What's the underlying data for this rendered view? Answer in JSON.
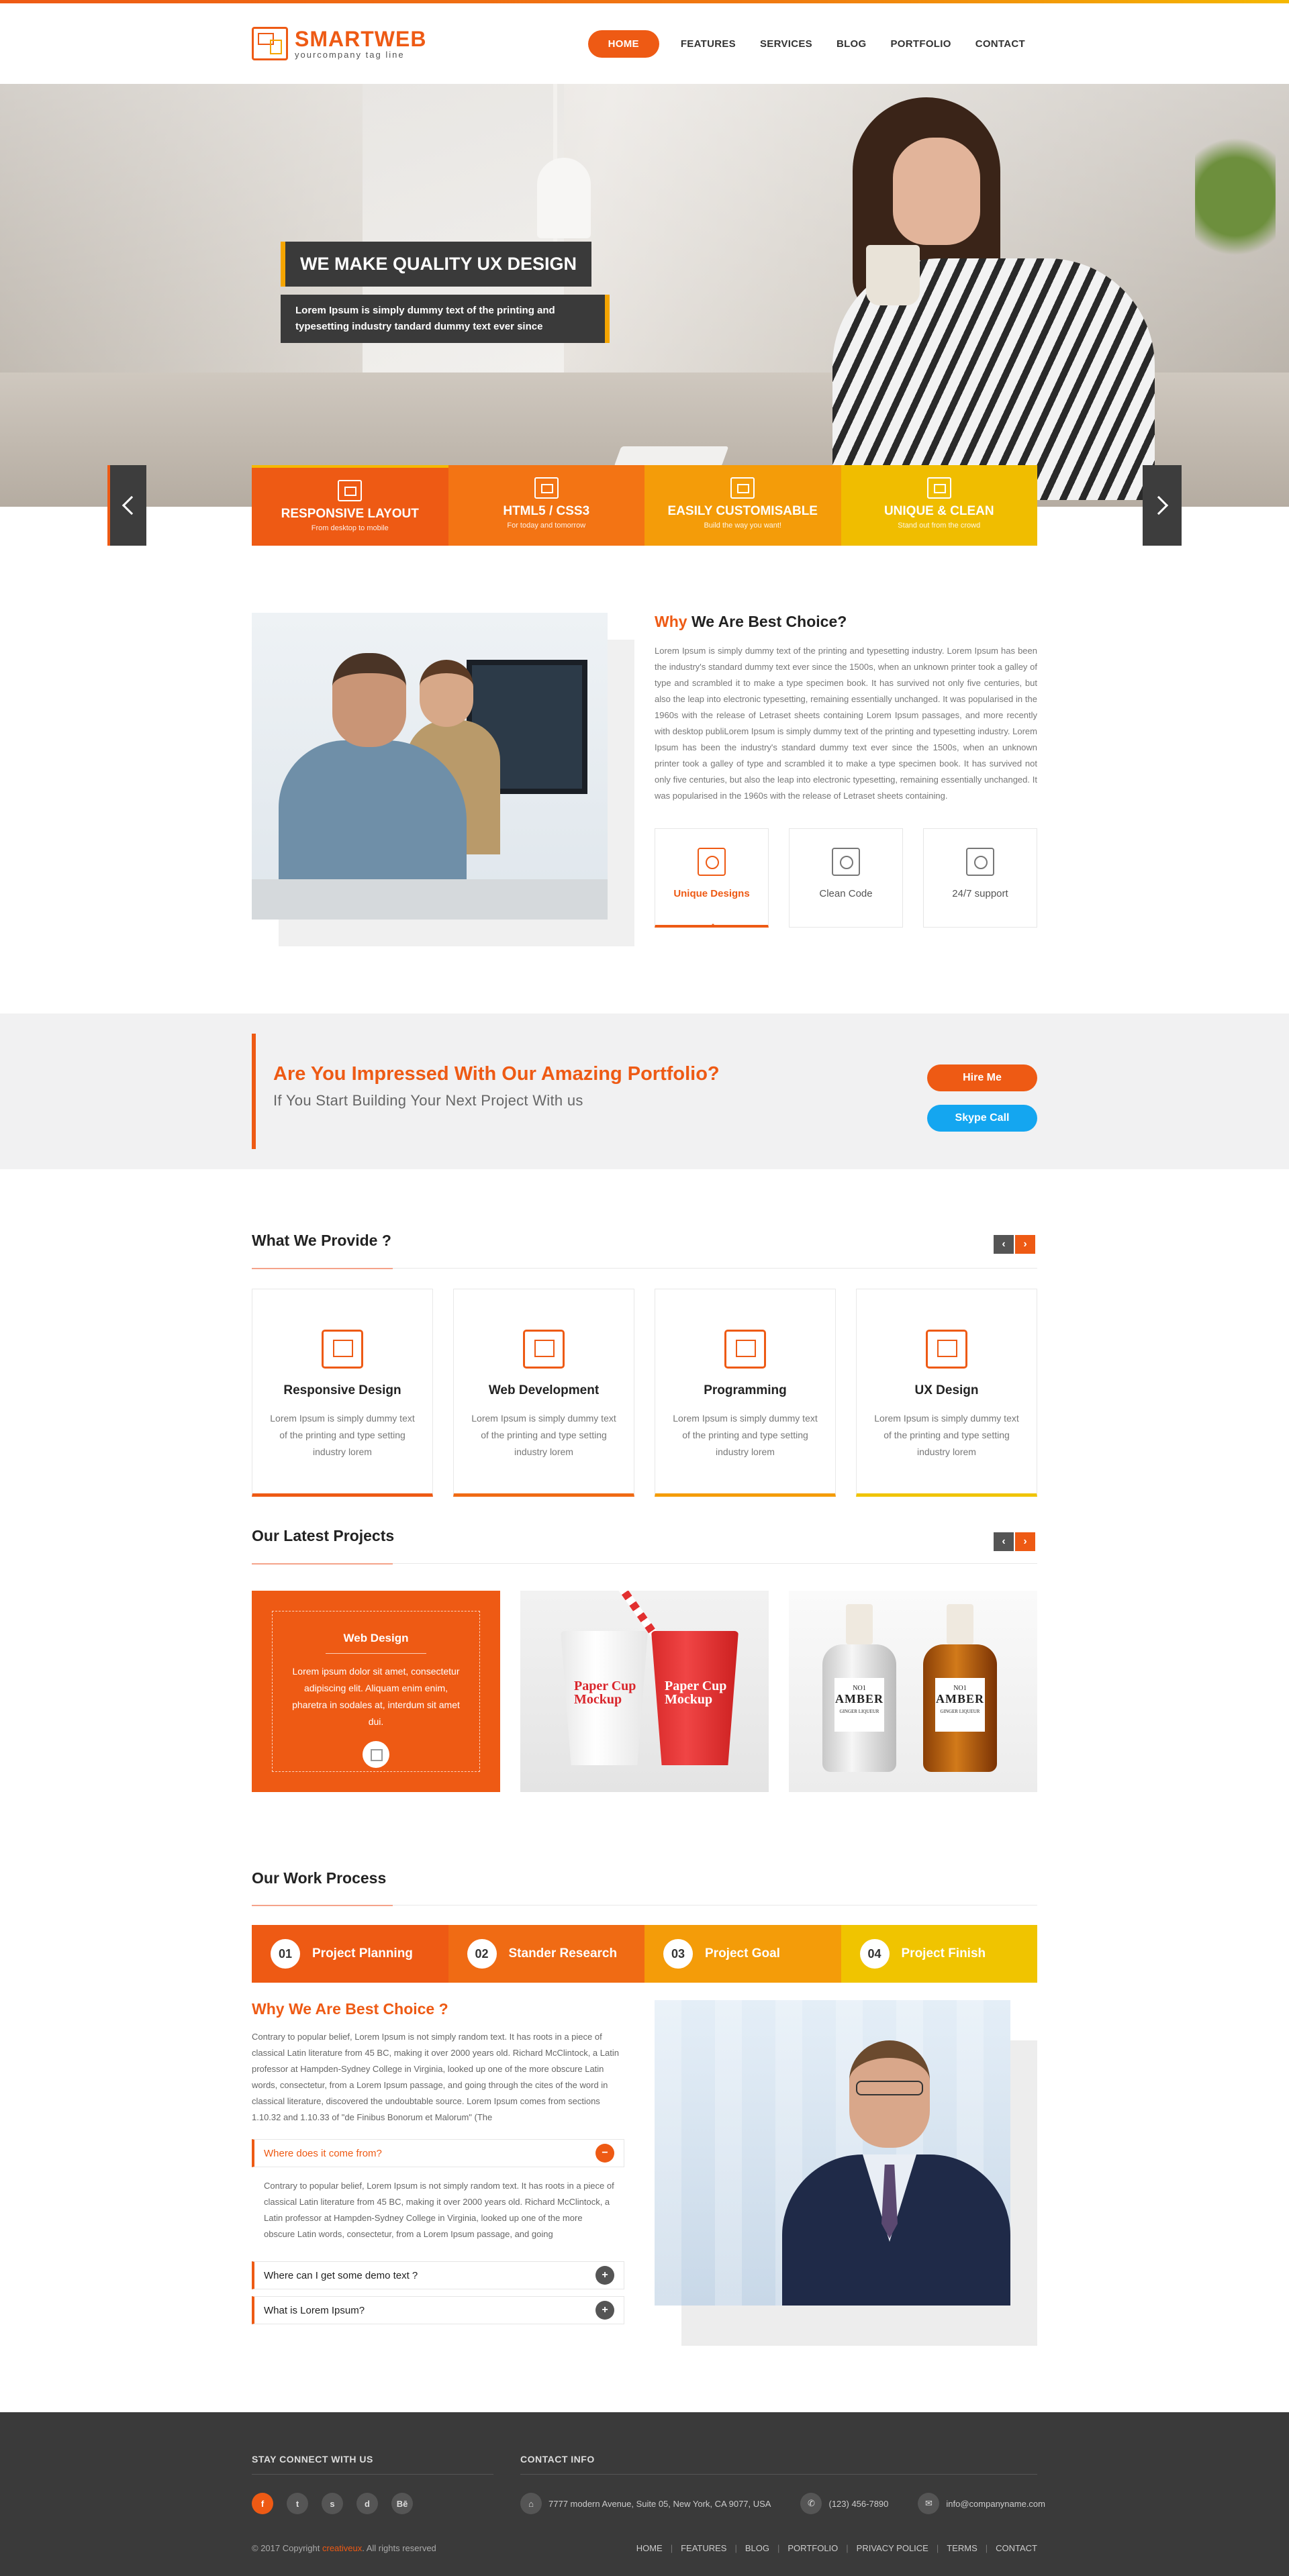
{
  "brand": {
    "name": "SMARTWEB",
    "tagline": "yourcompany tag line",
    "accent": "#ee5a14",
    "accent2": "#f5a500"
  },
  "nav": {
    "items": [
      "HOME",
      "FEATURES",
      "SERVICES",
      "BLOG",
      "PORTFOLIO",
      "CONTACT"
    ],
    "active": "HOME"
  },
  "hero": {
    "title": "WE MAKE QUALITY UX DESIGN",
    "subtitle": "Lorem Ipsum is simply dummy text of the printing and typesetting industry tandard dummy text ever since"
  },
  "features": [
    {
      "title": "RESPONSIVE LAYOUT",
      "sub": "From desktop to mobile",
      "icon": "responsive-icon"
    },
    {
      "title": "HTML5 / CSS3",
      "sub": "For today and tomorrow",
      "icon": "html5-icon"
    },
    {
      "title": "EASILY CUSTOMISABLE",
      "sub": "Build the way you want!",
      "icon": "code-icon"
    },
    {
      "title": "UNIQUE & CLEAN",
      "sub": "Stand out from the crowd",
      "icon": "unique-icon"
    }
  ],
  "why": {
    "title_accent": "Why",
    "title_rest": " We Are Best Choice?",
    "text": "Lorem Ipsum is simply dummy text of the printing and typesetting industry. Lorem Ipsum has been the industry's standard dummy text ever since the 1500s, when an unknown printer took a galley of type and scrambled it to make a type specimen book. It has survived not only five centuries, but also the leap into electronic typesetting, remaining essentially unchanged. It was popularised in the 1960s with the release of Letraset sheets containing Lorem Ipsum passages, and more recently with desktop publiLorem Ipsum is simply dummy text of the printing and typesetting industry. Lorem Ipsum has been the industry's standard dummy text ever since the 1500s, when an unknown printer took a galley of type and scrambled it to make a type specimen book. It has survived not only five centuries, but also the leap into electronic typesetting, remaining essentially unchanged. It was popularised in the 1960s with the release of Letraset sheets containing.",
    "cards": [
      {
        "label": "Unique Designs",
        "icon": "unique-designs-icon"
      },
      {
        "label": "Clean Code",
        "icon": "clean-code-icon"
      },
      {
        "label": "24/7 support",
        "icon": "support-icon"
      }
    ]
  },
  "cta": {
    "title": "Are You Impressed With Our Amazing Portfolio?",
    "subtitle": "If You Start Building Your Next Project With us",
    "hire": "Hire Me",
    "skype": "Skype Call"
  },
  "provide": {
    "title": "What We Provide ?",
    "items": [
      {
        "title": "Responsive Design",
        "text": "Lorem Ipsum is simply dummy text of the printing and type setting industry lorem",
        "icon": "responsive-design-icon"
      },
      {
        "title": "Web Development",
        "text": "Lorem Ipsum is simply dummy text of the printing and type setting industry lorem",
        "icon": "web-development-icon"
      },
      {
        "title": "Programming",
        "text": "Lorem Ipsum is simply dummy text of the printing and type setting industry lorem",
        "icon": "programming-icon"
      },
      {
        "title": "UX Design",
        "text": "Lorem Ipsum is simply dummy text of the printing and type setting industry lorem",
        "icon": "ux-design-icon"
      }
    ]
  },
  "projects": {
    "title": "Our Latest Projects",
    "active": {
      "title": "Web Design",
      "text": "Lorem ipsum dolor sit amet, consectetur adipiscing elit. Aliquam enim enim, pharetra in sodales at, interdum sit amet dui."
    },
    "cup_text": "Paper Cup Mockup",
    "bottle_top": "NO1",
    "bottle_name": "AMBER",
    "bottle_sub": "GINGER LIQUEUR"
  },
  "process": {
    "title": "Our Work Process",
    "steps": [
      {
        "num": "01",
        "label": "Project Planning"
      },
      {
        "num": "02",
        "label": "Stander Research"
      },
      {
        "num": "03",
        "label": "Project Goal"
      },
      {
        "num": "04",
        "label": "Project Finish"
      }
    ],
    "heading": "Why We Are Best Choice ?",
    "text": "Contrary to popular belief, Lorem Ipsum is not simply random text. It has roots in a piece of classical Latin literature from 45 BC, making it over 2000 years old. Richard McClintock, a Latin professor at Hampden-Sydney College in Virginia, looked up one of the more obscure Latin words, consectetur, from a Lorem Ipsum passage, and going through the cites of the word in classical literature, discovered the undoubtable source. Lorem Ipsum comes from sections 1.10.32 and 1.10.33 of \"de Finibus Bonorum et Malorum\" (The",
    "accordion": [
      {
        "q": "Where does it come from?",
        "open": true,
        "toggle": "−",
        "a": "Contrary to popular belief, Lorem Ipsum is not simply random text. It has roots in a piece of classical Latin literature from 45 BC, making it over 2000 years old. Richard McClintock, a Latin professor at Hampden-Sydney College in Virginia, looked up one of the more obscure Latin words, consectetur, from a Lorem Ipsum passage, and going"
      },
      {
        "q": "Where can I get some demo text ?",
        "open": false,
        "toggle": "+"
      },
      {
        "q": "What is Lorem Ipsum?",
        "open": false,
        "toggle": "+"
      }
    ]
  },
  "footer": {
    "stay_title": "STAY CONNECT WITH US",
    "contact_title": "CONTACT INFO",
    "socials": [
      "f",
      "t",
      "s",
      "d",
      "Bē"
    ],
    "address": "7777 modern Avenue, Suite 05, New York, CA 9077, USA",
    "phone": "(123) 456-7890",
    "email": "info@companyname.com",
    "copyright_pre": "© 2017 Copyright ",
    "copyright_brand": "creativeux",
    "copyright_post": ". All rights reserved",
    "links": [
      "HOME",
      "FEATURES",
      "BLOG",
      "PORTFOLIO",
      "PRIVACY POLICE",
      "TERMS",
      "CONTACT"
    ]
  },
  "arrows": {
    "prev": "‹",
    "next": "›"
  }
}
